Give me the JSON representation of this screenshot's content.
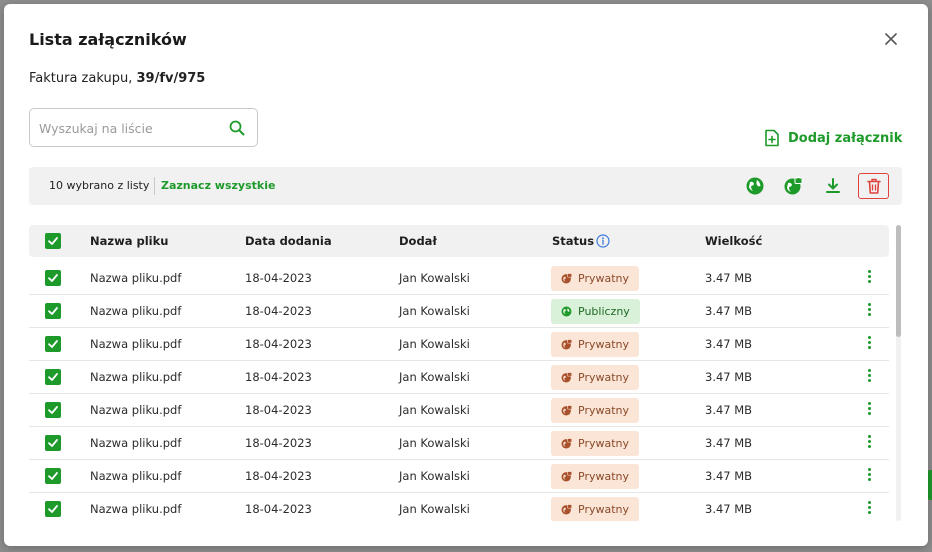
{
  "dialog": {
    "title": "Lista załączników",
    "subtitle_prefix": "Faktura zakupu, ",
    "subtitle_number": "39/fv/975",
    "close_icon": "close-icon"
  },
  "search": {
    "placeholder": "Wyszukaj na liście",
    "value": "",
    "icon": "search-icon"
  },
  "add_attachment": {
    "label": "Dodaj załącznik",
    "icon": "file-plus-icon"
  },
  "toolbar": {
    "selected_count": "10 wybrano z listy",
    "select_all": "Zaznacz wszystkie",
    "actions": [
      "globe-public-icon",
      "globe-private-icon",
      "download-icon",
      "trash-icon"
    ]
  },
  "table": {
    "columns": {
      "name": "Nazwa pliku",
      "date": "Data dodania",
      "added_by": "Dodał",
      "status": "Status",
      "size": "Wielkość"
    },
    "rows": [
      {
        "name": "Nazwa pliku.pdf",
        "date": "18-04-2023",
        "added_by": "Jan Kowalski",
        "status": "Prywatny",
        "status_type": "private",
        "size": "3.47 MB",
        "checked": true
      },
      {
        "name": "Nazwa pliku.pdf",
        "date": "18-04-2023",
        "added_by": "Jan Kowalski",
        "status": "Publiczny",
        "status_type": "public",
        "size": "3.47 MB",
        "checked": true
      },
      {
        "name": "Nazwa pliku.pdf",
        "date": "18-04-2023",
        "added_by": "Jan Kowalski",
        "status": "Prywatny",
        "status_type": "private",
        "size": "3.47 MB",
        "checked": true
      },
      {
        "name": "Nazwa pliku.pdf",
        "date": "18-04-2023",
        "added_by": "Jan Kowalski",
        "status": "Prywatny",
        "status_type": "private",
        "size": "3.47 MB",
        "checked": true
      },
      {
        "name": "Nazwa pliku.pdf",
        "date": "18-04-2023",
        "added_by": "Jan Kowalski",
        "status": "Prywatny",
        "status_type": "private",
        "size": "3.47 MB",
        "checked": true
      },
      {
        "name": "Nazwa pliku.pdf",
        "date": "18-04-2023",
        "added_by": "Jan Kowalski",
        "status": "Prywatny",
        "status_type": "private",
        "size": "3.47 MB",
        "checked": true
      },
      {
        "name": "Nazwa pliku.pdf",
        "date": "18-04-2023",
        "added_by": "Jan Kowalski",
        "status": "Prywatny",
        "status_type": "private",
        "size": "3.47 MB",
        "checked": true
      },
      {
        "name": "Nazwa pliku.pdf",
        "date": "18-04-2023",
        "added_by": "Jan Kowalski",
        "status": "Prywatny",
        "status_type": "private",
        "size": "3.47 MB",
        "checked": true
      }
    ]
  },
  "colors": {
    "accent": "#1e9a2b",
    "danger": "#e0413b",
    "private_bg": "#fbe5d6",
    "public_bg": "#d8f1d8"
  }
}
